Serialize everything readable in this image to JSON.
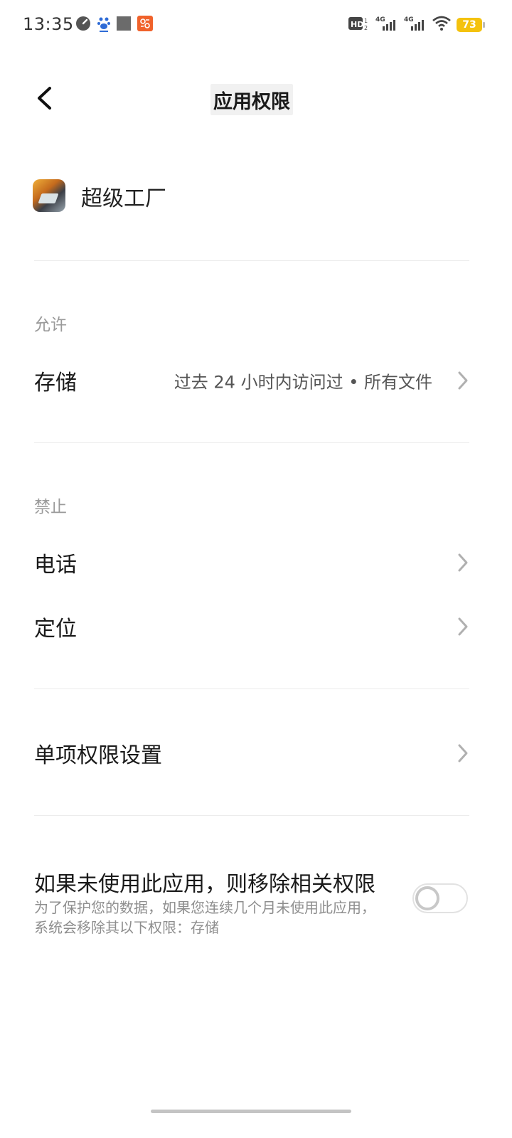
{
  "status_bar": {
    "time": "13:35",
    "battery": "73",
    "network_1": "4G",
    "network_2": "4G",
    "hd": "HD",
    "icons": [
      "speedometer-icon",
      "baidu-paw-icon",
      "gray-square-icon",
      "app-notification-icon",
      "hd-icon",
      "signal-icon",
      "signal-icon",
      "wifi-icon",
      "battery-icon"
    ]
  },
  "header": {
    "title": "应用权限",
    "back_icon": "chevron-left-icon"
  },
  "app": {
    "name": "超级工厂"
  },
  "allowed": {
    "label": "允许",
    "items": [
      {
        "title": "存储",
        "value": "过去 24 小时内访问过 • 所有文件"
      }
    ]
  },
  "denied": {
    "label": "禁止",
    "items": [
      {
        "title": "电话"
      },
      {
        "title": "定位"
      }
    ]
  },
  "individual": {
    "title": "单项权限设置"
  },
  "auto_revoke": {
    "title": "如果未使用此应用，则移除相关权限",
    "description": "为了保护您的数据，如果您连续几个月未使用此应用，系统会移除其以下权限：存储",
    "enabled": false
  },
  "colors": {
    "battery": "#f4c20d",
    "accent_orange": "#f0622b",
    "section_label": "#9a9a9a"
  }
}
